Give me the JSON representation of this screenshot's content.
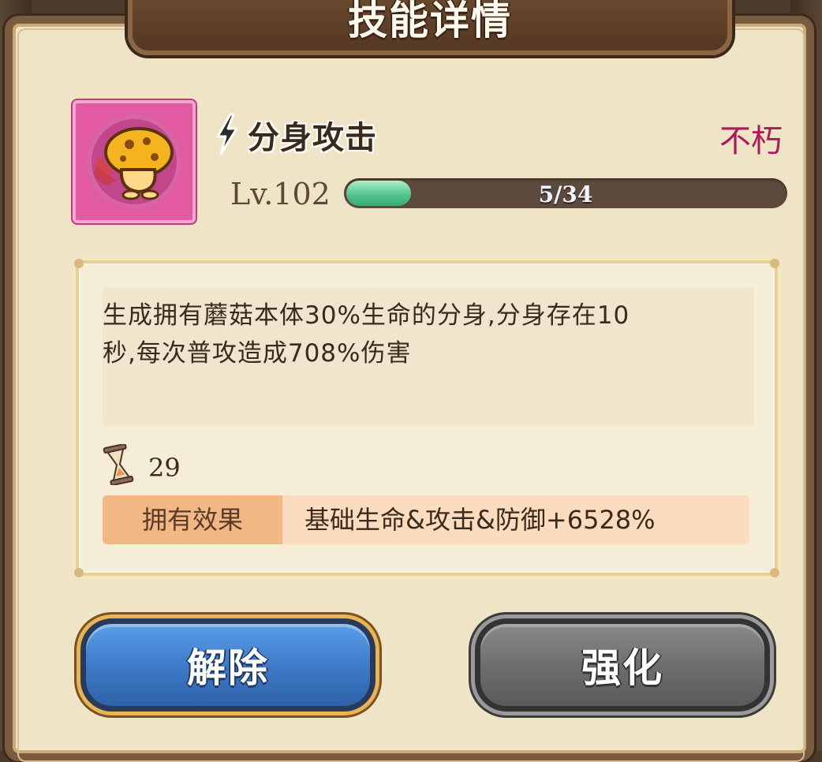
{
  "title": "技能详情",
  "skill": {
    "name": "分身攻击",
    "rarity": "不朽",
    "level": "Lv.102",
    "progress_text": "5/34",
    "progress_fraction": 0.147,
    "icon": "mushroom-icon",
    "type_icon": "lightning-bolt-icon"
  },
  "description": {
    "line1": "生成拥有蘑菇本体30%生命的分身,分身存在10",
    "line2": "秒,每次普攻造成708%伤害"
  },
  "cooldown": {
    "icon": "hourglass-icon",
    "value": "29"
  },
  "owned_effect": {
    "label": "拥有效果",
    "value": "基础生命&攻击&防御+6528%"
  },
  "buttons": {
    "release": "解除",
    "enhance": "强化"
  },
  "colors": {
    "rarity": "#b0185e",
    "xp_fill": "#4fc28a",
    "release_button": "#3c78c6",
    "enhance_button": "#6c6c6c"
  }
}
